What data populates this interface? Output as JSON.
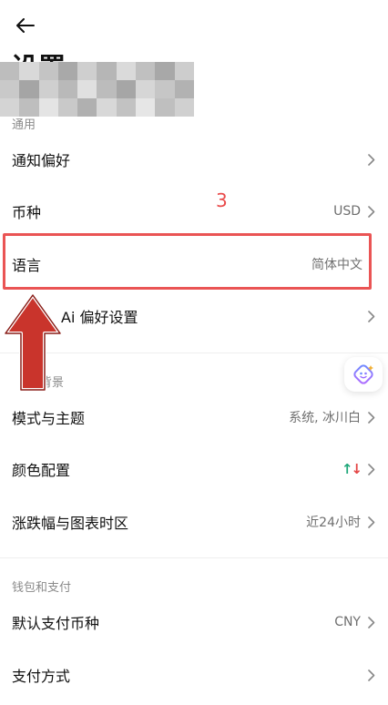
{
  "header": {
    "back_icon": "arrow-left-icon",
    "title": "设置"
  },
  "annotation": {
    "step_number": "3",
    "highlight_color": "#ea5454",
    "arrow_color": "#c9342c"
  },
  "sections": {
    "general": {
      "label": "通用",
      "items": [
        {
          "label": "通知偏好",
          "value": ""
        },
        {
          "label": "币种",
          "value": "USD"
        },
        {
          "label": "语言",
          "value": "简体中文"
        },
        {
          "label": "Ai 偏好设置",
          "value": ""
        }
      ]
    },
    "appearance": {
      "label": "背景",
      "items": [
        {
          "label": "模式与主题",
          "value": "系统, 冰川白"
        },
        {
          "label": "颜色配置",
          "value": ""
        },
        {
          "label": "涨跌幅与图表时区",
          "value": "近24小时"
        }
      ]
    },
    "wallet": {
      "label": "钱包和支付",
      "items": [
        {
          "label": "默认支付币种",
          "value": "CNY"
        },
        {
          "label": "支付方式",
          "value": ""
        }
      ]
    }
  },
  "colors": {
    "up": "#1fa77a",
    "down": "#e44545",
    "text_secondary": "#6f6f6f"
  }
}
